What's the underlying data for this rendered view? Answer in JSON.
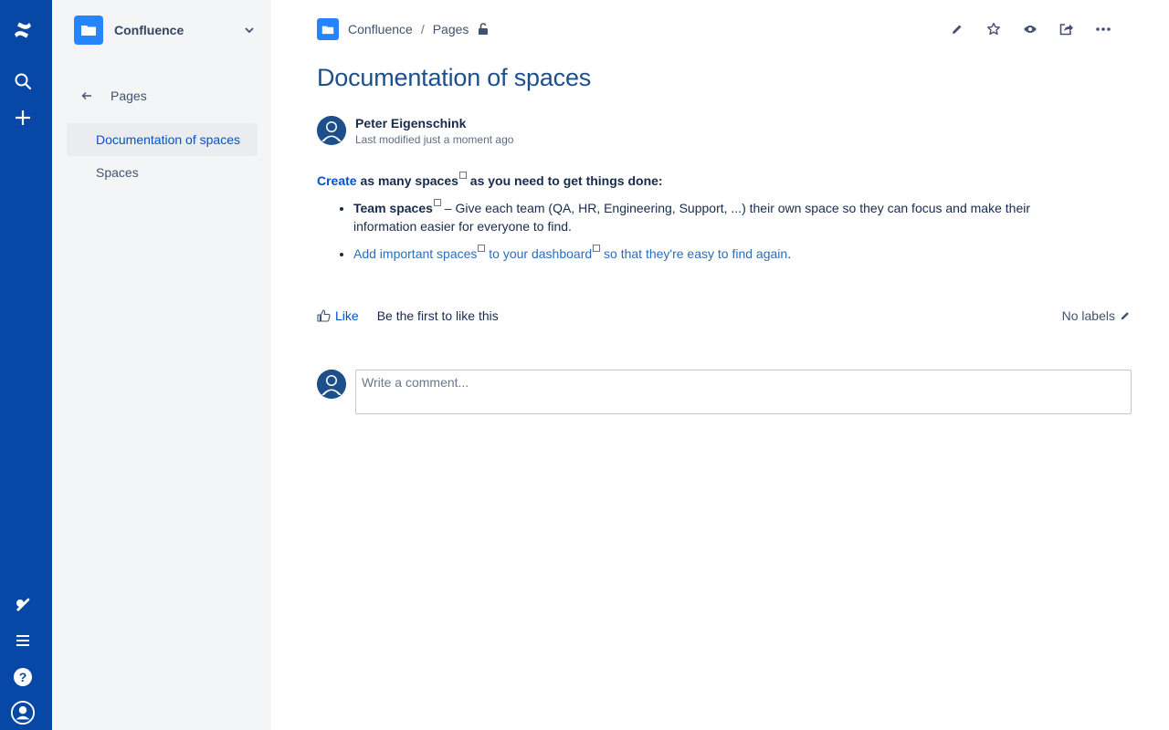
{
  "rail": {
    "icons": [
      "confluence-logo-icon",
      "search-icon",
      "create-icon",
      "notifications-icon",
      "menu-icon",
      "help-icon",
      "profile-icon"
    ]
  },
  "sidebar": {
    "space_name": "Confluence",
    "back_label": "Pages",
    "items": [
      {
        "label": "Documentation of spaces",
        "active": true
      },
      {
        "label": "Spaces",
        "active": false
      }
    ]
  },
  "breadcrumb": {
    "space": "Confluence",
    "separator": "/",
    "pages": "Pages"
  },
  "page": {
    "title": "Documentation of spaces",
    "author": "Peter Eigenschink",
    "modified": "Last modified just a moment ago"
  },
  "content": {
    "intro_link": "Create",
    "intro_mid": " as many spaces",
    "intro_end": " as you need to get things done:",
    "bullet1_bold": "Team spaces",
    "bullet1_text": " – Give each team (QA, HR, Engineering, Support, ...) their own space so they can focus and make their information easier for everyone to find.",
    "bullet2_a": "Add important spaces",
    "bullet2_b": " to your dashboard",
    "bullet2_c": " so that they're easy to find again",
    "bullet2_end": "."
  },
  "likes": {
    "like_label": "Like",
    "first_text": "Be the first to like this",
    "labels_text": "No labels"
  },
  "comment": {
    "placeholder": "Write a comment..."
  },
  "colors": {
    "rail": "#0747a6",
    "sidebar": "#f4f5f7",
    "title": "#1d4f8b",
    "link": "#0052cc",
    "space_avatar": "#2684ff"
  }
}
